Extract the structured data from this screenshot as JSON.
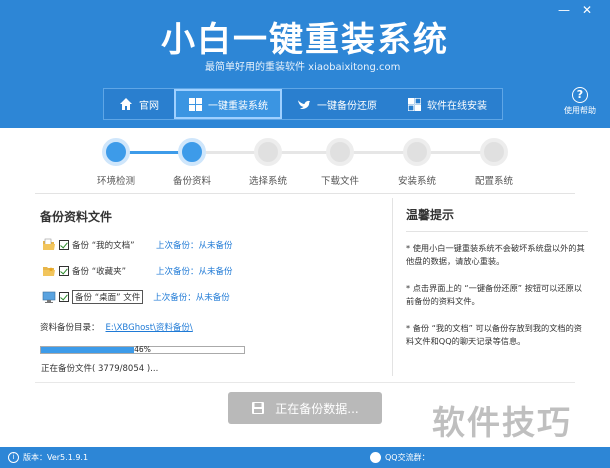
{
  "window": {
    "minimize_glyph": "—",
    "close_glyph": "✕"
  },
  "app": {
    "title": "小白一键重装系统",
    "subtitle": "最简单好用的重装软件 xiaobaixitong.com"
  },
  "nav": {
    "items": [
      {
        "label": "官网",
        "icon": "home-icon"
      },
      {
        "label": "一键重装系统",
        "icon": "windows-icon",
        "active": true
      },
      {
        "label": "一键备份还原",
        "icon": "bird-icon"
      },
      {
        "label": "软件在线安装",
        "icon": "apps-icon"
      }
    ]
  },
  "help": {
    "label": "使用帮助",
    "icon_glyph": "?"
  },
  "steps": [
    {
      "label": "环境检测",
      "done": true
    },
    {
      "label": "备份资料",
      "done": true
    },
    {
      "label": "选择系统",
      "done": false
    },
    {
      "label": "下载文件",
      "done": false
    },
    {
      "label": "安装系统",
      "done": false
    },
    {
      "label": "配置系统",
      "done": false
    }
  ],
  "backup": {
    "title": "备份资料文件",
    "rows": [
      {
        "name": "备份 “我的文档”",
        "last": "上次备份：从未备份",
        "icon": "document-folder-icon"
      },
      {
        "name": "备份 “收藏夹”",
        "last": "上次备份：从未备份",
        "icon": "favorites-folder-icon"
      },
      {
        "name": "备份 “桌面” 文件",
        "last": "上次备份：从未备份",
        "icon": "desktop-icon"
      }
    ],
    "dir_label": "资料备份目录：",
    "dir_value": "E:\\XBGhost\\资料备份\\",
    "progress_percent": 46,
    "progress_text": "46%",
    "status": "正在备份文件( 3779/8054 )..."
  },
  "tips": {
    "title": "温馨提示",
    "items": [
      "* 使用小白一键重装系统不会破坏系统盘以外的其他盘的数据，请放心重装。",
      "* 点击界面上的 “一键备份还原” 按钮可以还原以前备份的资料文件。",
      "* 备份 “我的文档” 可以备份存放到我的文档的资料文件和QQ的聊天记录等信息。"
    ]
  },
  "action": {
    "label": "正在备份数据..."
  },
  "watermark": "软件技巧",
  "footer": {
    "version": "版本：Ver5.1.9.1",
    "qq": "QQ交流群："
  },
  "colors": {
    "primary": "#2d86d6",
    "accent": "#3d9be9",
    "link": "#1f7ad6",
    "disabled": "#b9b9b9"
  }
}
